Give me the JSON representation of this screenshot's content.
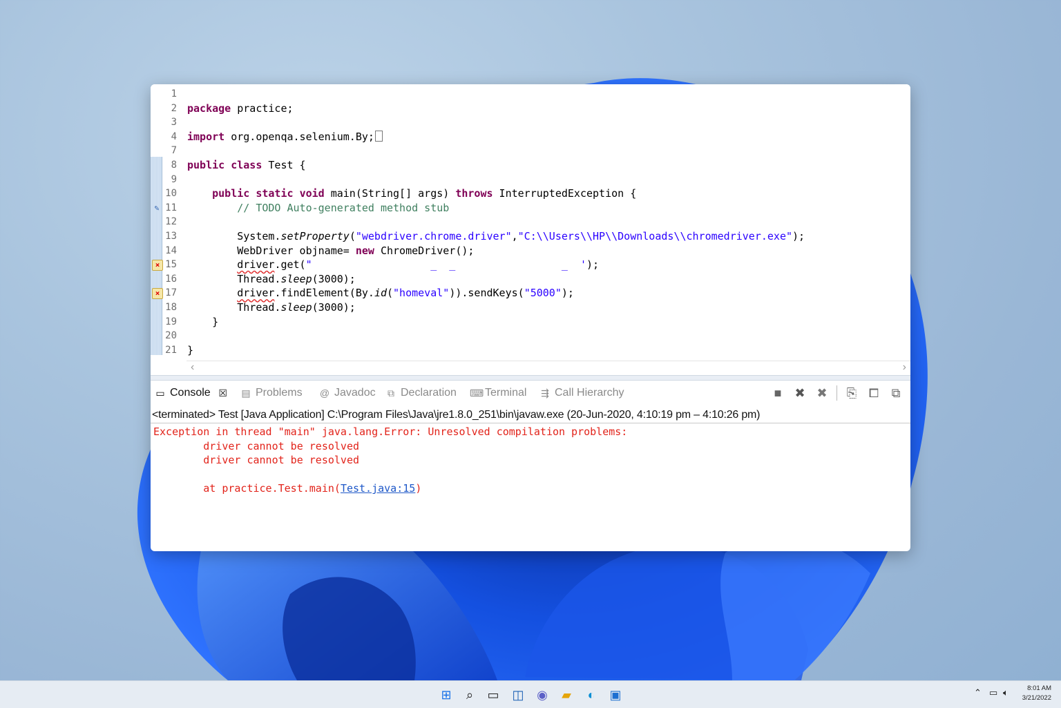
{
  "editor": {
    "lines": [
      {
        "n": "1",
        "parts": []
      },
      {
        "n": "2",
        "parts": [
          {
            "t": "package",
            "c": "kw"
          },
          {
            "t": " practice;",
            "c": ""
          }
        ]
      },
      {
        "n": "3",
        "parts": []
      },
      {
        "n": "4",
        "fold": "⊕",
        "parts": [
          {
            "t": "import",
            "c": "kw"
          },
          {
            "t": " org.openqa.selenium.By;",
            "c": ""
          },
          {
            "t": "⬚",
            "c": "box"
          }
        ]
      },
      {
        "n": "7",
        "parts": []
      },
      {
        "n": "8",
        "parts": [
          {
            "t": "public",
            "c": "kw"
          },
          {
            "t": " ",
            "c": ""
          },
          {
            "t": "class",
            "c": "kw"
          },
          {
            "t": " Test {",
            "c": ""
          }
        ]
      },
      {
        "n": "9",
        "parts": []
      },
      {
        "n": "10",
        "fold": "⊖",
        "parts": [
          {
            "t": "    ",
            "c": ""
          },
          {
            "t": "public",
            "c": "kw"
          },
          {
            "t": " ",
            "c": ""
          },
          {
            "t": "static",
            "c": "kw"
          },
          {
            "t": " ",
            "c": ""
          },
          {
            "t": "void",
            "c": "kw"
          },
          {
            "t": " main(String[] args) ",
            "c": ""
          },
          {
            "t": "throws",
            "c": "kw"
          },
          {
            "t": " InterruptedException {",
            "c": ""
          }
        ]
      },
      {
        "n": "11",
        "marker": "task",
        "parts": [
          {
            "t": "        // TODO Auto-generated method stub",
            "c": "cmt"
          }
        ]
      },
      {
        "n": "12",
        "parts": []
      },
      {
        "n": "13",
        "parts": [
          {
            "t": "        System.",
            "c": ""
          },
          {
            "t": "setProperty",
            "c": "it"
          },
          {
            "t": "(",
            "c": ""
          },
          {
            "t": "\"webdriver.chrome.driver\"",
            "c": "str"
          },
          {
            "t": ",",
            "c": ""
          },
          {
            "t": "\"C:\\\\Users\\\\HP\\\\Downloads\\\\chromedriver.exe\"",
            "c": "str"
          },
          {
            "t": ");",
            "c": ""
          }
        ]
      },
      {
        "n": "14",
        "parts": [
          {
            "t": "        WebDriver objname= ",
            "c": ""
          },
          {
            "t": "new",
            "c": "kw"
          },
          {
            "t": " ChromeDriver();",
            "c": ""
          }
        ]
      },
      {
        "n": "15",
        "marker": "err",
        "parts": [
          {
            "t": "        ",
            "c": ""
          },
          {
            "t": "driver",
            "c": "err"
          },
          {
            "t": ".get(",
            "c": ""
          },
          {
            "t": "\"                   _  _                 _  '",
            "c": "str"
          },
          {
            "t": ");",
            "c": ""
          }
        ]
      },
      {
        "n": "16",
        "parts": [
          {
            "t": "        Thread.",
            "c": ""
          },
          {
            "t": "sleep",
            "c": "it"
          },
          {
            "t": "(3000);",
            "c": ""
          }
        ]
      },
      {
        "n": "17",
        "marker": "err",
        "parts": [
          {
            "t": "        ",
            "c": ""
          },
          {
            "t": "driver",
            "c": "err"
          },
          {
            "t": ".findElement(By.",
            "c": ""
          },
          {
            "t": "id",
            "c": "it"
          },
          {
            "t": "(",
            "c": ""
          },
          {
            "t": "\"homeval\"",
            "c": "str"
          },
          {
            "t": ")).sendKeys(",
            "c": ""
          },
          {
            "t": "\"5000\"",
            "c": "str"
          },
          {
            "t": ");",
            "c": ""
          }
        ]
      },
      {
        "n": "18",
        "parts": [
          {
            "t": "        Thread.",
            "c": ""
          },
          {
            "t": "sleep",
            "c": "it"
          },
          {
            "t": "(3000);",
            "c": ""
          }
        ]
      },
      {
        "n": "19",
        "parts": [
          {
            "t": "    }",
            "c": ""
          }
        ]
      },
      {
        "n": "20",
        "parts": []
      },
      {
        "n": "21",
        "parts": [
          {
            "t": "}",
            "c": ""
          }
        ]
      }
    ]
  },
  "tabs": [
    {
      "label": "Console",
      "icon": "▭",
      "active": true,
      "close": "☒"
    },
    {
      "label": "Problems",
      "icon": "▤"
    },
    {
      "label": "Javadoc",
      "icon": "@"
    },
    {
      "label": "Declaration",
      "icon": "⧉"
    },
    {
      "label": "Terminal",
      "icon": "⌨"
    },
    {
      "label": "Call Hierarchy",
      "icon": "⇶"
    }
  ],
  "toolbar_icons": [
    "■",
    "✖",
    "✖",
    "⎘",
    "⧠",
    "⧉"
  ],
  "console": {
    "terminated": "<terminated> Test [Java Application] C:\\Program Files\\Java\\jre1.8.0_251\\bin\\javaw.exe  (20-Jun-2020, 4:10:19 pm – 4:10:26 pm)",
    "line1": "Exception in thread \"main\" java.lang.Error: Unresolved compilation problems: ",
    "line2": "\tdriver cannot be resolved",
    "line3": "\tdriver cannot be resolved",
    "line4_prefix": "\tat practice.Test.main(",
    "line4_link": "Test.java:15",
    "line4_suffix": ")"
  },
  "taskbar": {
    "time": "8:01 AM",
    "date": "3/21/2022"
  },
  "colors": {
    "keyword": "#7f0055",
    "string": "#2a00ff",
    "comment": "#3f7f5f",
    "error": "#e2231a",
    "link": "#1d57c8"
  }
}
